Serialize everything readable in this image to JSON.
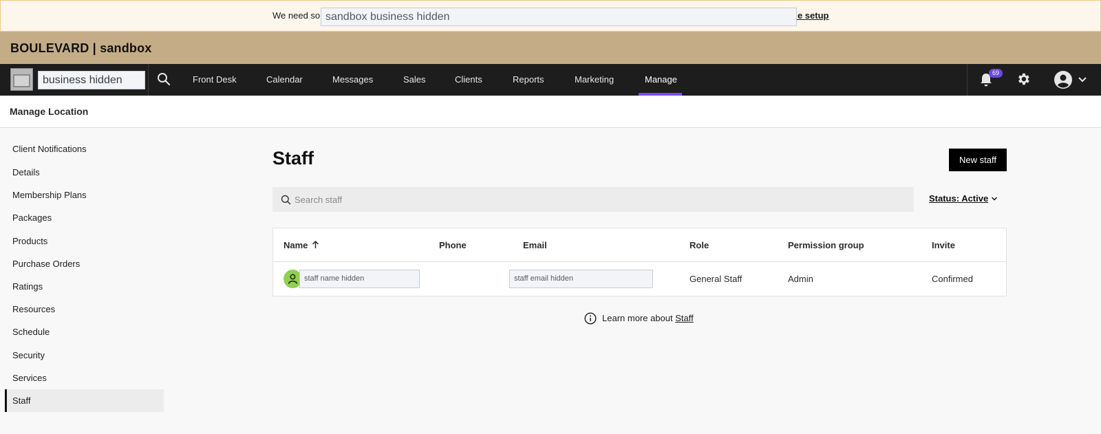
{
  "banner": {
    "text": "We need so",
    "link": "ue setup",
    "redacted": "sandbox business hidden"
  },
  "brand": {
    "title": "BOULEVARD | sandbox"
  },
  "nav": {
    "business_redacted": "business hidden",
    "items": [
      "Front Desk",
      "Calendar",
      "Messages",
      "Sales",
      "Clients",
      "Reports",
      "Marketing",
      "Manage"
    ],
    "active": "Manage",
    "notification_count": "69",
    "accent": "#7b4cf0"
  },
  "subheader": {
    "title": "Manage Location"
  },
  "sidebar": {
    "items": [
      "Client Notifications",
      "Details",
      "Membership Plans",
      "Packages",
      "Products",
      "Purchase Orders",
      "Ratings",
      "Resources",
      "Schedule",
      "Security",
      "Services",
      "Staff"
    ],
    "active": "Staff"
  },
  "main": {
    "title": "Staff",
    "new_button": "New staff",
    "search_placeholder": "Search staff",
    "status_filter": "Status: Active",
    "table": {
      "headers": [
        "Name",
        "Phone",
        "Email",
        "Role",
        "Permission group",
        "Invite"
      ],
      "rows": [
        {
          "name": "staff name hidden",
          "phone": "",
          "email": "staff email hidden",
          "role": "General Staff",
          "permission_group": "Admin",
          "invite": "Confirmed"
        }
      ]
    },
    "learn_more_prefix": "Learn more about",
    "learn_more_link": "Staff"
  }
}
